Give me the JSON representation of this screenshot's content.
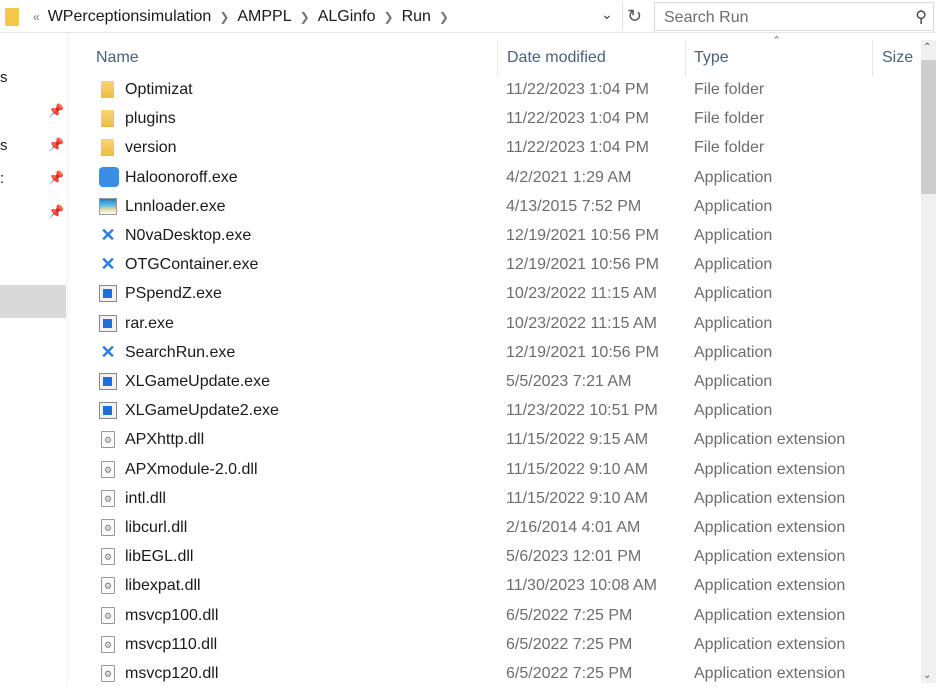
{
  "address": {
    "overflow": "«",
    "crumbs": [
      "WPerceptionsimulation",
      "AMPPL",
      "ALGinfo",
      "Run"
    ]
  },
  "search": {
    "placeholder": "Search Run"
  },
  "sidebar": {
    "labels": [
      "s",
      "s",
      ":"
    ]
  },
  "columns": {
    "name": "Name",
    "date": "Date modified",
    "type": "Type",
    "size": "Size"
  },
  "files": [
    {
      "name": "Optimizat",
      "date": "11/22/2023 1:04 PM",
      "type": "File folder",
      "icon": "folder"
    },
    {
      "name": "plugins",
      "date": "11/22/2023 1:04 PM",
      "type": "File folder",
      "icon": "folder"
    },
    {
      "name": "version",
      "date": "11/22/2023 1:04 PM",
      "type": "File folder",
      "icon": "folder"
    },
    {
      "name": "Haloonoroff.exe",
      "date": "4/2/2021 1:29 AM",
      "type": "Application",
      "icon": "halo"
    },
    {
      "name": "Lnnloader.exe",
      "date": "4/13/2015 7:52 PM",
      "type": "Application",
      "icon": "lnn"
    },
    {
      "name": "N0vaDesktop.exe",
      "date": "12/19/2021 10:56 PM",
      "type": "Application",
      "icon": "nova"
    },
    {
      "name": "OTGContainer.exe",
      "date": "12/19/2021 10:56 PM",
      "type": "Application",
      "icon": "nova"
    },
    {
      "name": "PSpendZ.exe",
      "date": "10/23/2022 11:15 AM",
      "type": "Application",
      "icon": "app"
    },
    {
      "name": "rar.exe",
      "date": "10/23/2022 11:15 AM",
      "type": "Application",
      "icon": "app"
    },
    {
      "name": "SearchRun.exe",
      "date": "12/19/2021 10:56 PM",
      "type": "Application",
      "icon": "nova"
    },
    {
      "name": "XLGameUpdate.exe",
      "date": "5/5/2023 7:21 AM",
      "type": "Application",
      "icon": "app"
    },
    {
      "name": "XLGameUpdate2.exe",
      "date": "11/23/2022 10:51 PM",
      "type": "Application",
      "icon": "app"
    },
    {
      "name": "APXhttp.dll",
      "date": "11/15/2022 9:15 AM",
      "type": "Application extension",
      "icon": "dll"
    },
    {
      "name": "APXmodule-2.0.dll",
      "date": "11/15/2022 9:10 AM",
      "type": "Application extension",
      "icon": "dll"
    },
    {
      "name": "intl.dll",
      "date": "11/15/2022 9:10 AM",
      "type": "Application extension",
      "icon": "dll"
    },
    {
      "name": "libcurl.dll",
      "date": "2/16/2014 4:01 AM",
      "type": "Application extension",
      "icon": "dll"
    },
    {
      "name": "libEGL.dll",
      "date": "5/6/2023 12:01 PM",
      "type": "Application extension",
      "icon": "dll"
    },
    {
      "name": "libexpat.dll",
      "date": "11/30/2023 10:08 AM",
      "type": "Application extension",
      "icon": "dll"
    },
    {
      "name": "msvcp100.dll",
      "date": "6/5/2022 7:25 PM",
      "type": "Application extension",
      "icon": "dll"
    },
    {
      "name": "msvcp110.dll",
      "date": "6/5/2022 7:25 PM",
      "type": "Application extension",
      "icon": "dll"
    },
    {
      "name": "msvcp120.dll",
      "date": "6/5/2022 7:25 PM",
      "type": "Application extension",
      "icon": "dll"
    }
  ]
}
